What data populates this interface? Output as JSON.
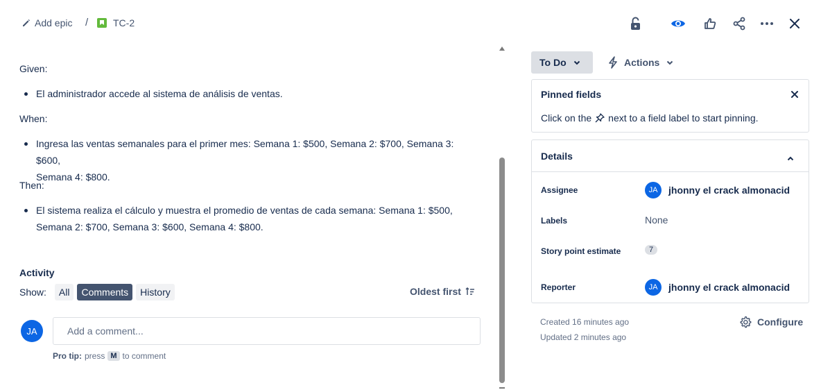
{
  "breadcrumb": {
    "add_epic": "Add epic",
    "separator": "/",
    "issue_key": "TC-2"
  },
  "toolbar": {
    "icons": [
      "lock-icon",
      "watch-icon",
      "like-icon",
      "share-icon",
      "more-icon",
      "close-icon"
    ]
  },
  "description": {
    "given_label": "Given:",
    "given_item": "El administrador accede al sistema de análisis de ventas.",
    "when_label": "When:",
    "when_item_line1": "Ingresa las ventas semanales para el primer mes: Semana 1: $500, Semana 2: $700, Semana 3: $600,",
    "when_item_line2": "Semana 4: $800.",
    "then_label": "Then:",
    "then_item_line1": "El sistema realiza el cálculo y muestra el promedio de ventas de cada semana: Semana 1: $500,",
    "then_item_line2": "Semana 2: $700, Semana 3: $600, Semana 4: $800."
  },
  "activity": {
    "title": "Activity",
    "show_label": "Show:",
    "filters": [
      {
        "label": "All",
        "active": false
      },
      {
        "label": "Comments",
        "active": true
      },
      {
        "label": "History",
        "active": false
      }
    ],
    "sort_label": "Oldest first",
    "comment_avatar": "JA",
    "comment_placeholder": "Add a comment...",
    "protip_label": "Pro tip:",
    "protip_press": "press",
    "protip_key": "M",
    "protip_suffix": "to comment"
  },
  "status": {
    "label": "To Do",
    "actions_label": "Actions"
  },
  "pinned": {
    "title": "Pinned fields",
    "text_before": "Click on the",
    "text_after": "next to a field label to start pinning."
  },
  "details": {
    "title": "Details",
    "assignee_label": "Assignee",
    "assignee_initials": "JA",
    "assignee_name": "jhonny el crack almonacid",
    "labels_label": "Labels",
    "labels_value": "None",
    "story_points_label": "Story point estimate",
    "story_points_value": "7",
    "reporter_label": "Reporter",
    "reporter_initials": "JA",
    "reporter_name": "jhonny el crack almonacid"
  },
  "meta": {
    "created": "Created 16 minutes ago",
    "updated": "Updated 2 minutes ago",
    "configure_label": "Configure"
  },
  "colors": {
    "accent": "#0c66e4",
    "active_chip": "#44546f",
    "text": "#172b4d",
    "story_green": "#63ba3c"
  }
}
